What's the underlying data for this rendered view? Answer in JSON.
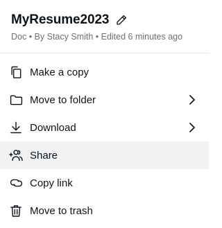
{
  "document": {
    "title": "MyResume2023",
    "meta": "Doc • By Stacy Smith • Edited 6 minutes ago"
  },
  "menu": {
    "items": [
      {
        "label": "Make a copy",
        "icon": "copy-icon",
        "submenu": false
      },
      {
        "label": "Move to folder",
        "icon": "folder-icon",
        "submenu": true
      },
      {
        "label": "Download",
        "icon": "download-icon",
        "submenu": true
      },
      {
        "label": "Share",
        "icon": "add-person-icon",
        "submenu": false,
        "highlighted": true
      },
      {
        "label": "Copy link",
        "icon": "link-icon",
        "submenu": false
      },
      {
        "label": "Move to trash",
        "icon": "trash-icon",
        "submenu": false
      }
    ]
  },
  "colors": {
    "text": "#0e1318",
    "muted": "#6b7075",
    "hover_background": "#f1f2f4",
    "divider": "#e6e8ea"
  }
}
